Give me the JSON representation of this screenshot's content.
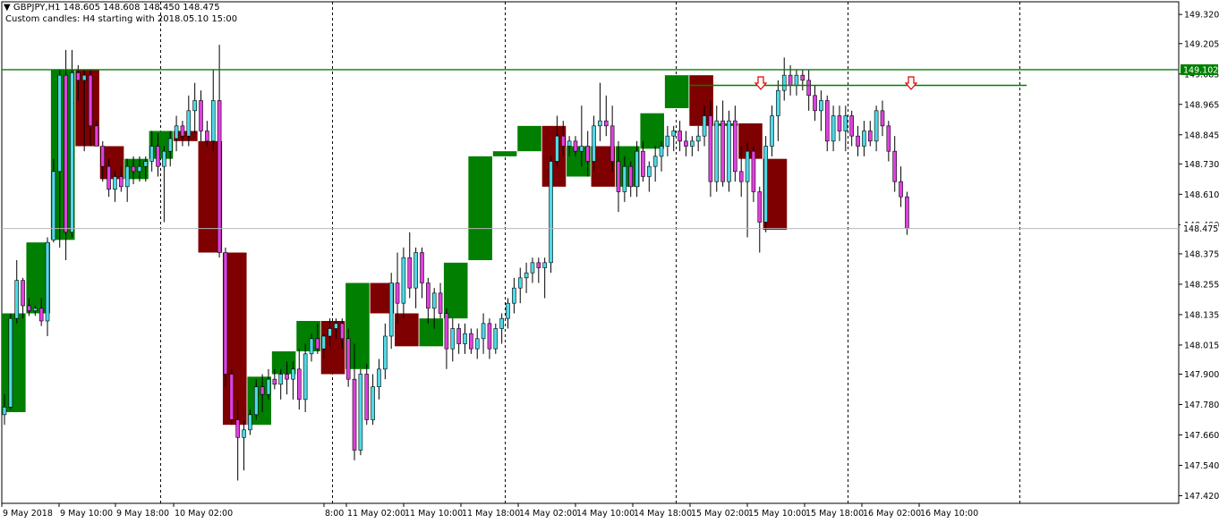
{
  "header": {
    "symbol_line": "GBPJPY,H1  148.605 148.608 148.450 148.475",
    "custom_line": "Custom candles: H4 starting with 2018.05.10 15:00"
  },
  "colors": {
    "bull_h4": "#007f00",
    "bear_h4": "#7f0000",
    "bull_h1": "#4fd9e6",
    "bear_h1": "#e040e0",
    "resistance": "#008000",
    "arrow": "#e00000"
  },
  "chart_data": {
    "type": "candlestick",
    "symbol": "GBPJPY",
    "timeframe": "H1",
    "last_price": 148.475,
    "resistance_levels": [
      149.102,
      149.04
    ],
    "y_ticks": [
      "149.320",
      "149.205",
      "149.085",
      "148.965",
      "148.845",
      "148.730",
      "148.610",
      "148.490",
      "148.375",
      "148.255",
      "148.135",
      "148.015",
      "147.900",
      "147.780",
      "147.660",
      "147.540",
      "147.420"
    ],
    "x_labels": [
      "9 May 2018",
      "9 May 10:00",
      "9 May 18:00",
      "10 May 02:00",
      "8:00",
      "11 May 02:00",
      "11 May 10:00",
      "11 May 18:00",
      "14 May 02:00",
      "14 May 10:00",
      "14 May 18:00",
      "15 May 02:00",
      "15 May 10:00",
      "15 May 18:00",
      "16 May 02:00",
      "16 May 10:00"
    ],
    "price_labels": [
      "149.102",
      "148.475"
    ],
    "ylim": [
      147.39,
      149.37
    ],
    "h4_candles": [
      {
        "o": 147.75,
        "h": 148.15,
        "l": 147.74,
        "c": 148.14
      },
      {
        "o": 148.14,
        "h": 148.42,
        "l": 148.13,
        "c": 148.42
      },
      {
        "o": 148.43,
        "h": 149.1,
        "l": 148.42,
        "c": 149.1
      },
      {
        "o": 149.1,
        "h": 149.1,
        "l": 148.8,
        "c": 148.8
      },
      {
        "o": 148.8,
        "h": 148.8,
        "l": 148.67,
        "c": 148.67
      },
      {
        "o": 148.67,
        "h": 148.75,
        "l": 148.66,
        "c": 148.75
      },
      {
        "o": 148.75,
        "h": 148.86,
        "l": 148.74,
        "c": 148.86
      },
      {
        "o": 148.86,
        "h": 148.87,
        "l": 148.82,
        "c": 148.82
      },
      {
        "o": 148.82,
        "h": 148.82,
        "l": 148.38,
        "c": 148.38
      },
      {
        "o": 148.38,
        "h": 148.38,
        "l": 147.7,
        "c": 147.7
      },
      {
        "o": 147.7,
        "h": 147.89,
        "l": 147.69,
        "c": 147.89
      },
      {
        "o": 147.9,
        "h": 147.99,
        "l": 147.89,
        "c": 147.99
      },
      {
        "o": 147.99,
        "h": 148.11,
        "l": 147.98,
        "c": 148.11
      },
      {
        "o": 148.11,
        "h": 148.11,
        "l": 147.9,
        "c": 147.9
      },
      {
        "o": 147.92,
        "h": 148.26,
        "l": 147.91,
        "c": 148.26
      },
      {
        "o": 148.26,
        "h": 148.26,
        "l": 148.14,
        "c": 148.14
      },
      {
        "o": 148.14,
        "h": 148.14,
        "l": 148.01,
        "c": 148.01
      },
      {
        "o": 148.01,
        "h": 148.12,
        "l": 148.0,
        "c": 148.12
      },
      {
        "o": 148.12,
        "h": 148.34,
        "l": 148.12,
        "c": 148.34
      },
      {
        "o": 148.35,
        "h": 148.76,
        "l": 148.34,
        "c": 148.76
      },
      {
        "o": 148.76,
        "h": 148.78,
        "l": 148.75,
        "c": 148.78
      },
      {
        "o": 148.78,
        "h": 148.88,
        "l": 148.77,
        "c": 148.88
      },
      {
        "o": 148.88,
        "h": 148.88,
        "l": 148.64,
        "c": 148.64
      },
      {
        "o": 148.68,
        "h": 148.8,
        "l": 148.67,
        "c": 148.8
      },
      {
        "o": 148.8,
        "h": 148.8,
        "l": 148.64,
        "c": 148.64
      },
      {
        "o": 148.64,
        "h": 148.8,
        "l": 148.63,
        "c": 148.8
      },
      {
        "o": 148.79,
        "h": 148.93,
        "l": 148.78,
        "c": 148.93
      },
      {
        "o": 148.95,
        "h": 149.08,
        "l": 148.94,
        "c": 149.08
      },
      {
        "o": 149.08,
        "h": 149.08,
        "l": 148.88,
        "c": 148.88
      },
      {
        "o": 148.88,
        "h": 148.89,
        "l": 148.87,
        "c": 148.89
      },
      {
        "o": 148.89,
        "h": 148.89,
        "l": 148.75,
        "c": 148.75
      },
      {
        "o": 148.75,
        "h": 148.75,
        "l": 148.47,
        "c": 148.47
      }
    ],
    "h1_candles": [
      {
        "o": 147.74,
        "h": 147.82,
        "l": 147.7,
        "c": 147.77
      },
      {
        "o": 147.77,
        "h": 148.14,
        "l": 147.76,
        "c": 148.12
      },
      {
        "o": 148.12,
        "h": 148.35,
        "l": 148.1,
        "c": 148.27
      },
      {
        "o": 148.27,
        "h": 148.28,
        "l": 148.12,
        "c": 148.17
      },
      {
        "o": 148.17,
        "h": 148.2,
        "l": 148.13,
        "c": 148.15
      },
      {
        "o": 148.15,
        "h": 148.17,
        "l": 148.13,
        "c": 148.16
      },
      {
        "o": 148.16,
        "h": 148.2,
        "l": 148.09,
        "c": 148.11
      },
      {
        "o": 148.11,
        "h": 148.44,
        "l": 148.05,
        "c": 148.42
      },
      {
        "o": 148.43,
        "h": 148.75,
        "l": 148.42,
        "c": 148.7
      },
      {
        "o": 148.7,
        "h": 149.1,
        "l": 148.4,
        "c": 149.08
      },
      {
        "o": 149.08,
        "h": 149.18,
        "l": 148.35,
        "c": 148.46
      },
      {
        "o": 148.46,
        "h": 149.18,
        "l": 148.44,
        "c": 149.09
      },
      {
        "o": 149.09,
        "h": 149.12,
        "l": 148.98,
        "c": 149.06
      },
      {
        "o": 149.06,
        "h": 149.1,
        "l": 148.78,
        "c": 149.08
      },
      {
        "o": 149.08,
        "h": 149.1,
        "l": 148.8,
        "c": 148.88
      },
      {
        "o": 148.88,
        "h": 148.9,
        "l": 148.8,
        "c": 148.8
      },
      {
        "o": 148.8,
        "h": 148.82,
        "l": 148.66,
        "c": 148.72
      },
      {
        "o": 148.72,
        "h": 148.75,
        "l": 148.6,
        "c": 148.63
      },
      {
        "o": 148.63,
        "h": 148.7,
        "l": 148.58,
        "c": 148.68
      },
      {
        "o": 148.68,
        "h": 148.72,
        "l": 148.62,
        "c": 148.64
      },
      {
        "o": 148.64,
        "h": 148.75,
        "l": 148.58,
        "c": 148.72
      },
      {
        "o": 148.72,
        "h": 148.76,
        "l": 148.65,
        "c": 148.7
      },
      {
        "o": 148.7,
        "h": 148.76,
        "l": 148.66,
        "c": 148.72
      },
      {
        "o": 148.72,
        "h": 148.76,
        "l": 148.66,
        "c": 148.74
      },
      {
        "o": 148.74,
        "h": 148.86,
        "l": 148.7,
        "c": 148.8
      },
      {
        "o": 148.8,
        "h": 148.85,
        "l": 148.68,
        "c": 148.72
      },
      {
        "o": 148.72,
        "h": 148.8,
        "l": 148.5,
        "c": 148.78
      },
      {
        "o": 148.78,
        "h": 148.86,
        "l": 148.72,
        "c": 148.83
      },
      {
        "o": 148.83,
        "h": 148.92,
        "l": 148.78,
        "c": 148.88
      },
      {
        "o": 148.88,
        "h": 148.9,
        "l": 148.8,
        "c": 148.84
      },
      {
        "o": 148.84,
        "h": 149.0,
        "l": 148.8,
        "c": 148.94
      },
      {
        "o": 148.94,
        "h": 149.05,
        "l": 148.85,
        "c": 148.98
      },
      {
        "o": 148.98,
        "h": 149.02,
        "l": 148.82,
        "c": 148.86
      },
      {
        "o": 148.86,
        "h": 148.9,
        "l": 148.8,
        "c": 148.82
      },
      {
        "o": 148.82,
        "h": 149.1,
        "l": 148.78,
        "c": 148.98
      },
      {
        "o": 148.98,
        "h": 149.2,
        "l": 148.36,
        "c": 148.38
      },
      {
        "o": 148.38,
        "h": 148.4,
        "l": 147.85,
        "c": 147.9
      },
      {
        "o": 147.9,
        "h": 147.92,
        "l": 147.7,
        "c": 147.72
      },
      {
        "o": 147.72,
        "h": 147.8,
        "l": 147.48,
        "c": 147.65
      },
      {
        "o": 147.65,
        "h": 147.72,
        "l": 147.52,
        "c": 147.68
      },
      {
        "o": 147.68,
        "h": 147.76,
        "l": 147.66,
        "c": 147.74
      },
      {
        "o": 147.74,
        "h": 147.88,
        "l": 147.72,
        "c": 147.85
      },
      {
        "o": 147.85,
        "h": 147.9,
        "l": 147.75,
        "c": 147.82
      },
      {
        "o": 147.82,
        "h": 147.92,
        "l": 147.8,
        "c": 147.88
      },
      {
        "o": 147.88,
        "h": 147.92,
        "l": 147.84,
        "c": 147.86
      },
      {
        "o": 147.86,
        "h": 147.92,
        "l": 147.8,
        "c": 147.9
      },
      {
        "o": 147.9,
        "h": 147.95,
        "l": 147.82,
        "c": 147.88
      },
      {
        "o": 147.88,
        "h": 147.95,
        "l": 147.8,
        "c": 147.92
      },
      {
        "o": 147.92,
        "h": 148.0,
        "l": 147.76,
        "c": 147.8
      },
      {
        "o": 147.8,
        "h": 148.02,
        "l": 147.75,
        "c": 147.98
      },
      {
        "o": 147.98,
        "h": 148.06,
        "l": 147.95,
        "c": 148.04
      },
      {
        "o": 148.04,
        "h": 148.1,
        "l": 147.98,
        "c": 148.0
      },
      {
        "o": 148.0,
        "h": 148.06,
        "l": 147.96,
        "c": 148.05
      },
      {
        "o": 148.05,
        "h": 148.12,
        "l": 148.0,
        "c": 148.08
      },
      {
        "o": 148.08,
        "h": 148.12,
        "l": 148.04,
        "c": 148.1
      },
      {
        "o": 148.1,
        "h": 148.12,
        "l": 148.0,
        "c": 148.04
      },
      {
        "o": 148.04,
        "h": 148.08,
        "l": 147.85,
        "c": 147.88
      },
      {
        "o": 147.88,
        "h": 148.02,
        "l": 147.56,
        "c": 147.6
      },
      {
        "o": 147.6,
        "h": 147.92,
        "l": 147.58,
        "c": 147.9
      },
      {
        "o": 147.9,
        "h": 147.94,
        "l": 147.7,
        "c": 147.72
      },
      {
        "o": 147.72,
        "h": 147.9,
        "l": 147.7,
        "c": 147.85
      },
      {
        "o": 147.85,
        "h": 147.96,
        "l": 147.8,
        "c": 147.92
      },
      {
        "o": 147.92,
        "h": 148.1,
        "l": 147.88,
        "c": 148.05
      },
      {
        "o": 148.05,
        "h": 148.3,
        "l": 148.0,
        "c": 148.26
      },
      {
        "o": 148.26,
        "h": 148.38,
        "l": 148.1,
        "c": 148.18
      },
      {
        "o": 148.18,
        "h": 148.4,
        "l": 148.12,
        "c": 148.36
      },
      {
        "o": 148.36,
        "h": 148.46,
        "l": 148.2,
        "c": 148.24
      },
      {
        "o": 148.24,
        "h": 148.4,
        "l": 148.16,
        "c": 148.38
      },
      {
        "o": 148.38,
        "h": 148.4,
        "l": 148.2,
        "c": 148.26
      },
      {
        "o": 148.26,
        "h": 148.28,
        "l": 148.1,
        "c": 148.16
      },
      {
        "o": 148.16,
        "h": 148.24,
        "l": 148.08,
        "c": 148.22
      },
      {
        "o": 148.22,
        "h": 148.26,
        "l": 148.12,
        "c": 148.14
      },
      {
        "o": 148.14,
        "h": 148.16,
        "l": 147.92,
        "c": 148.0
      },
      {
        "o": 148.0,
        "h": 148.12,
        "l": 147.95,
        "c": 148.08
      },
      {
        "o": 148.08,
        "h": 148.1,
        "l": 147.98,
        "c": 148.02
      },
      {
        "o": 148.02,
        "h": 148.1,
        "l": 147.98,
        "c": 148.06
      },
      {
        "o": 148.06,
        "h": 148.08,
        "l": 147.98,
        "c": 148.0
      },
      {
        "o": 148.0,
        "h": 148.08,
        "l": 147.96,
        "c": 148.04
      },
      {
        "o": 148.04,
        "h": 148.14,
        "l": 147.98,
        "c": 148.1
      },
      {
        "o": 148.1,
        "h": 148.12,
        "l": 147.96,
        "c": 148.0
      },
      {
        "o": 148.0,
        "h": 148.1,
        "l": 147.98,
        "c": 148.08
      },
      {
        "o": 148.08,
        "h": 148.14,
        "l": 148.02,
        "c": 148.12
      },
      {
        "o": 148.12,
        "h": 148.2,
        "l": 148.08,
        "c": 148.18
      },
      {
        "o": 148.18,
        "h": 148.28,
        "l": 148.14,
        "c": 148.24
      },
      {
        "o": 148.24,
        "h": 148.32,
        "l": 148.18,
        "c": 148.28
      },
      {
        "o": 148.28,
        "h": 148.34,
        "l": 148.22,
        "c": 148.3
      },
      {
        "o": 148.3,
        "h": 148.36,
        "l": 148.26,
        "c": 148.34
      },
      {
        "o": 148.34,
        "h": 148.36,
        "l": 148.26,
        "c": 148.32
      },
      {
        "o": 148.32,
        "h": 148.36,
        "l": 148.2,
        "c": 148.34
      },
      {
        "o": 148.34,
        "h": 148.76,
        "l": 148.3,
        "c": 148.74
      },
      {
        "o": 148.74,
        "h": 148.92,
        "l": 148.72,
        "c": 148.84
      },
      {
        "o": 148.84,
        "h": 148.9,
        "l": 148.76,
        "c": 148.8
      },
      {
        "o": 148.8,
        "h": 148.84,
        "l": 148.76,
        "c": 148.82
      },
      {
        "o": 148.82,
        "h": 148.84,
        "l": 148.76,
        "c": 148.78
      },
      {
        "o": 148.78,
        "h": 148.96,
        "l": 148.72,
        "c": 148.8
      },
      {
        "o": 148.8,
        "h": 148.86,
        "l": 148.68,
        "c": 148.74
      },
      {
        "o": 148.74,
        "h": 148.92,
        "l": 148.7,
        "c": 148.88
      },
      {
        "o": 148.88,
        "h": 149.05,
        "l": 148.82,
        "c": 148.9
      },
      {
        "o": 148.9,
        "h": 149.0,
        "l": 148.84,
        "c": 148.88
      },
      {
        "o": 148.88,
        "h": 148.96,
        "l": 148.7,
        "c": 148.74
      },
      {
        "o": 148.74,
        "h": 148.82,
        "l": 148.54,
        "c": 148.62
      },
      {
        "o": 148.62,
        "h": 148.76,
        "l": 148.58,
        "c": 148.72
      },
      {
        "o": 148.72,
        "h": 148.74,
        "l": 148.6,
        "c": 148.64
      },
      {
        "o": 148.64,
        "h": 148.82,
        "l": 148.6,
        "c": 148.78
      },
      {
        "o": 148.78,
        "h": 148.82,
        "l": 148.66,
        "c": 148.68
      },
      {
        "o": 148.68,
        "h": 148.74,
        "l": 148.62,
        "c": 148.72
      },
      {
        "o": 148.72,
        "h": 148.8,
        "l": 148.66,
        "c": 148.76
      },
      {
        "o": 148.76,
        "h": 148.82,
        "l": 148.7,
        "c": 148.8
      },
      {
        "o": 148.8,
        "h": 148.88,
        "l": 148.76,
        "c": 148.84
      },
      {
        "o": 148.84,
        "h": 148.88,
        "l": 148.78,
        "c": 148.86
      },
      {
        "o": 148.86,
        "h": 148.9,
        "l": 148.78,
        "c": 148.82
      },
      {
        "o": 148.82,
        "h": 148.86,
        "l": 148.76,
        "c": 148.8
      },
      {
        "o": 148.8,
        "h": 148.84,
        "l": 148.76,
        "c": 148.82
      },
      {
        "o": 148.82,
        "h": 148.88,
        "l": 148.78,
        "c": 148.84
      },
      {
        "o": 148.84,
        "h": 148.96,
        "l": 148.8,
        "c": 148.92
      },
      {
        "o": 148.92,
        "h": 148.98,
        "l": 148.6,
        "c": 148.66
      },
      {
        "o": 148.66,
        "h": 148.96,
        "l": 148.62,
        "c": 148.9
      },
      {
        "o": 148.9,
        "h": 148.98,
        "l": 148.64,
        "c": 148.66
      },
      {
        "o": 148.66,
        "h": 148.94,
        "l": 148.62,
        "c": 148.9
      },
      {
        "o": 148.9,
        "h": 148.96,
        "l": 148.66,
        "c": 148.7
      },
      {
        "o": 148.7,
        "h": 148.8,
        "l": 148.6,
        "c": 148.66
      },
      {
        "o": 148.66,
        "h": 148.82,
        "l": 148.44,
        "c": 148.78
      },
      {
        "o": 148.78,
        "h": 148.8,
        "l": 148.58,
        "c": 148.62
      },
      {
        "o": 148.62,
        "h": 148.64,
        "l": 148.38,
        "c": 148.5
      },
      {
        "o": 148.5,
        "h": 148.84,
        "l": 148.46,
        "c": 148.8
      },
      {
        "o": 148.8,
        "h": 148.96,
        "l": 148.76,
        "c": 148.92
      },
      {
        "o": 148.92,
        "h": 149.06,
        "l": 148.82,
        "c": 149.02
      },
      {
        "o": 149.02,
        "h": 149.15,
        "l": 148.98,
        "c": 149.08
      },
      {
        "o": 149.08,
        "h": 149.12,
        "l": 149.0,
        "c": 149.04
      },
      {
        "o": 149.04,
        "h": 149.1,
        "l": 149.0,
        "c": 149.08
      },
      {
        "o": 149.08,
        "h": 149.1,
        "l": 149.02,
        "c": 149.06
      },
      {
        "o": 149.06,
        "h": 149.1,
        "l": 148.94,
        "c": 149.0
      },
      {
        "o": 149.0,
        "h": 149.04,
        "l": 148.9,
        "c": 148.94
      },
      {
        "o": 148.94,
        "h": 149.02,
        "l": 148.86,
        "c": 148.98
      },
      {
        "o": 148.98,
        "h": 149.0,
        "l": 148.78,
        "c": 148.82
      },
      {
        "o": 148.82,
        "h": 148.96,
        "l": 148.78,
        "c": 148.92
      },
      {
        "o": 148.92,
        "h": 148.96,
        "l": 148.82,
        "c": 148.86
      },
      {
        "o": 148.86,
        "h": 148.96,
        "l": 148.78,
        "c": 148.92
      },
      {
        "o": 148.92,
        "h": 148.94,
        "l": 148.8,
        "c": 148.84
      },
      {
        "o": 148.84,
        "h": 148.88,
        "l": 148.76,
        "c": 148.8
      },
      {
        "o": 148.8,
        "h": 148.9,
        "l": 148.76,
        "c": 148.86
      },
      {
        "o": 148.86,
        "h": 148.9,
        "l": 148.8,
        "c": 148.82
      },
      {
        "o": 148.82,
        "h": 148.96,
        "l": 148.78,
        "c": 148.94
      },
      {
        "o": 148.94,
        "h": 148.98,
        "l": 148.84,
        "c": 148.88
      },
      {
        "o": 148.88,
        "h": 148.9,
        "l": 148.74,
        "c": 148.78
      },
      {
        "o": 148.78,
        "h": 148.84,
        "l": 148.62,
        "c": 148.66
      },
      {
        "o": 148.66,
        "h": 148.72,
        "l": 148.56,
        "c": 148.6
      },
      {
        "o": 148.6,
        "h": 148.62,
        "l": 148.45,
        "c": 148.475
      }
    ]
  }
}
